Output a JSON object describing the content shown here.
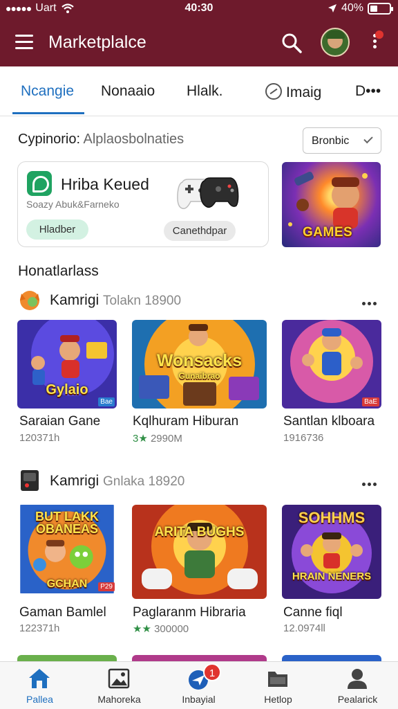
{
  "status_bar": {
    "carrier": "Uart",
    "time": "40:30",
    "battery": "40%"
  },
  "app_bar": {
    "title": "Marketplalce"
  },
  "tabs": [
    {
      "label": "Ncangie",
      "active": true
    },
    {
      "label": "Nonaaio"
    },
    {
      "label": "Hlalk."
    },
    {
      "label": "Imaig",
      "icon": "compass-icon"
    },
    {
      "label": "D•••"
    }
  ],
  "section": {
    "title": "Cypinorio:",
    "subtitle": "Alplaosbolnaties",
    "sort_label": "Bronbic"
  },
  "featured": {
    "title": "Hriba Keued",
    "subtitle": "Soazy Abuk&Farneko",
    "primary_button": "Hladber",
    "secondary_button": "Canethdpar",
    "banner_label": "GAMES"
  },
  "categories_heading": "Honatlarlass",
  "categories": [
    {
      "name": "Kamrigi",
      "meta": "Tolakn 18900",
      "games": [
        {
          "art_text": "Gylaio",
          "tag": "Bae",
          "title": "Saraian Gane",
          "meta": "120371h"
        },
        {
          "art_text": "Wonsacks",
          "art_sub": "Gunaibrao",
          "title": "Kqlhuram Hiburan",
          "meta": "2990M",
          "meta_prefix": "3★"
        },
        {
          "art_text": "",
          "tag": "BaE",
          "title": "Santlan klboara",
          "meta": "1916736"
        }
      ]
    },
    {
      "name": "Kamrigi",
      "meta": "Gnlaka 18920",
      "games": [
        {
          "art_text": "BUT LAKK OBANEAS",
          "art_sub": "GCHAN",
          "tag": "P29",
          "title": "Gaman Bamlel",
          "meta": "122371h"
        },
        {
          "art_text": "ARITA BUGHS",
          "title": "Paglaranm Hibraria",
          "meta": "300000",
          "meta_prefix": "★★"
        },
        {
          "art_text": "SOHHMS",
          "art_sub": "HRAIN NENERS",
          "title": "Canne fiql",
          "meta": "12.0974ll"
        }
      ]
    }
  ],
  "bottom_nav": [
    {
      "label": "Pallea",
      "icon": "home-icon",
      "active": true
    },
    {
      "label": "Mahoreka",
      "icon": "image-frame-icon"
    },
    {
      "label": "Inbayial",
      "icon": "paper-plane-icon",
      "badge": "1"
    },
    {
      "label": "Hetlop",
      "icon": "folder-icon"
    },
    {
      "label": "Pealarick",
      "icon": "person-icon"
    }
  ],
  "colors": {
    "app_bar": "#6e1a2c",
    "accent": "#1e6fbf",
    "badge": "#e0342f",
    "success": "#1fa361"
  }
}
